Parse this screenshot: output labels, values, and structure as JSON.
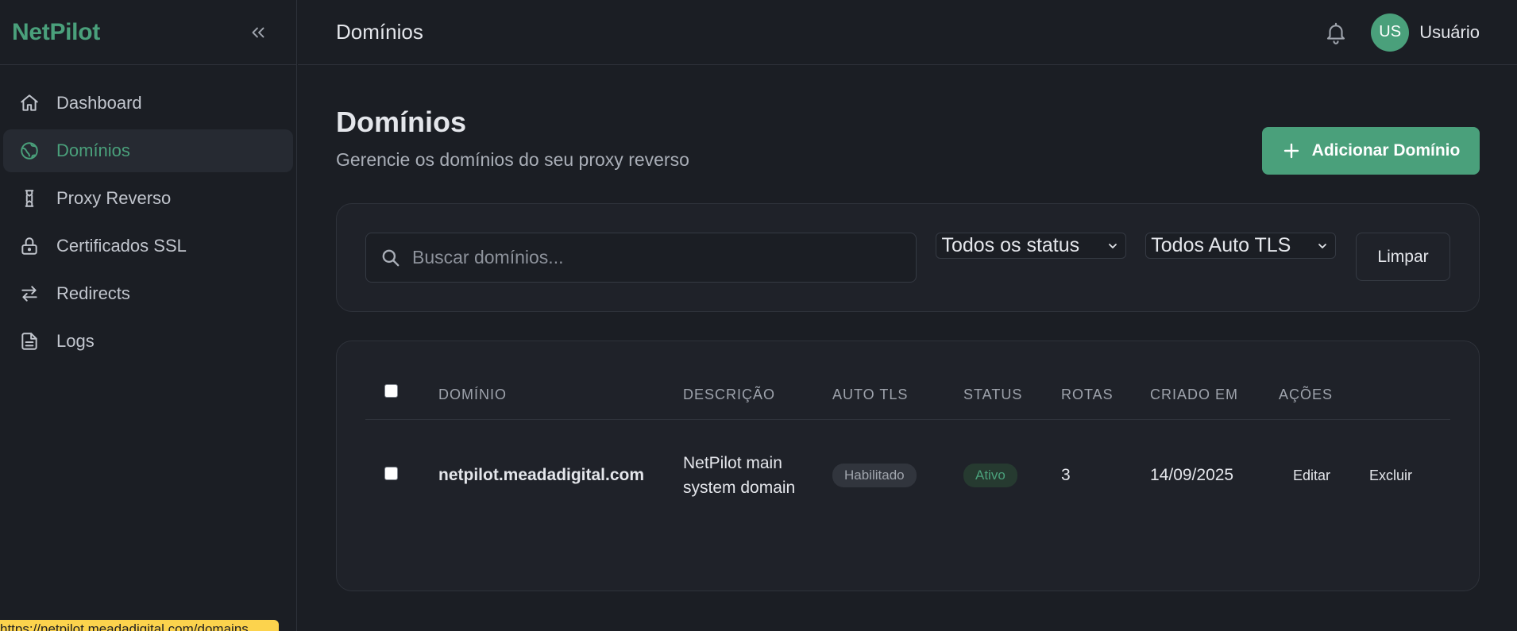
{
  "app": {
    "brand": "NetPilot"
  },
  "sidebar": {
    "items": [
      {
        "label": "Dashboard",
        "icon": "home-icon"
      },
      {
        "label": "Domínios",
        "icon": "globe-icon",
        "active": true
      },
      {
        "label": "Proxy Reverso",
        "icon": "proxy-icon"
      },
      {
        "label": "Certificados SSL",
        "icon": "lock-icon"
      },
      {
        "label": "Redirects",
        "icon": "arrows-exchange-icon"
      },
      {
        "label": "Logs",
        "icon": "document-icon"
      }
    ]
  },
  "topbar": {
    "title": "Domínios",
    "avatar_initials": "US",
    "username": "Usuário"
  },
  "page": {
    "title": "Domínios",
    "subtitle": "Gerencie os domínios do seu proxy reverso",
    "add_button": "Adicionar Domínio"
  },
  "filters": {
    "search_placeholder": "Buscar domínios...",
    "status_select": "Todos os status",
    "tls_select": "Todos Auto TLS",
    "clear_button": "Limpar"
  },
  "table": {
    "headers": {
      "domain": "DOMÍNIO",
      "description": "DESCRIÇÃO",
      "auto_tls": "AUTO TLS",
      "status": "STATUS",
      "routes": "ROTAS",
      "created": "CRIADO EM",
      "actions": "AÇÕES"
    },
    "rows": [
      {
        "domain": "netpilot.meadadigital.com",
        "description": "NetPilot main system domain",
        "auto_tls": "Habilitado",
        "status": "Ativo",
        "routes": "3",
        "created": "14/09/2025",
        "edit": "Editar",
        "delete": "Excluir"
      }
    ]
  },
  "statusbar": {
    "url": "https://netpilot.meadadigital.com/domains"
  },
  "colors": {
    "accent": "#4aa07b",
    "background": "#1b1e24",
    "card": "#1f2229",
    "statusbar": "#fcd34d"
  }
}
